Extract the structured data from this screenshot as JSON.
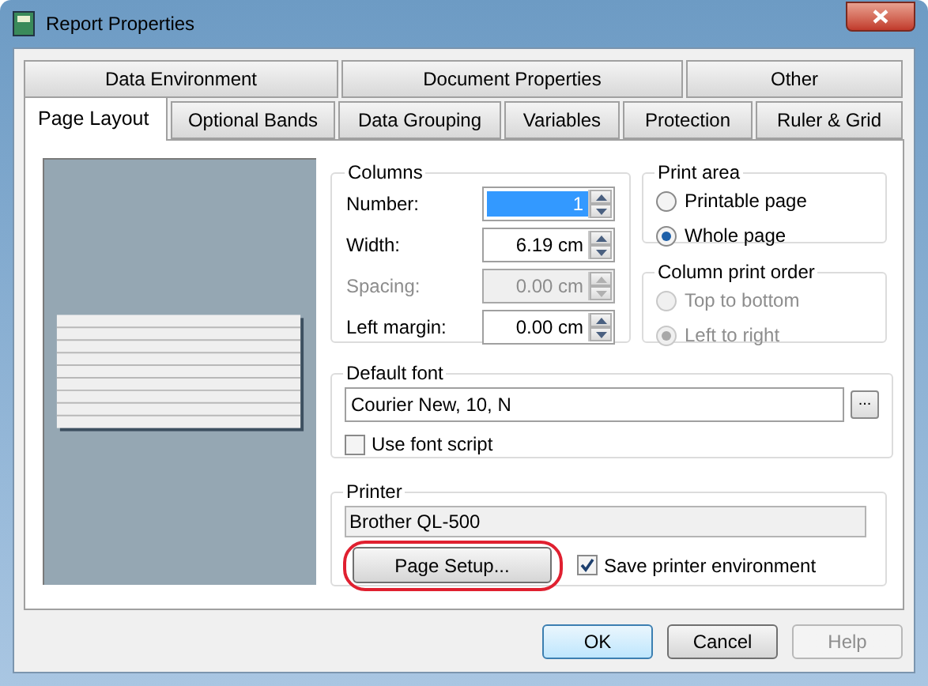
{
  "window": {
    "title": "Report Properties"
  },
  "tab_rows": [
    [
      {
        "label": "Data Environment",
        "selected": false
      },
      {
        "label": "Document Properties",
        "selected": false
      },
      {
        "label": "Other",
        "selected": false
      }
    ],
    [
      {
        "label": "Page Layout",
        "selected": true
      },
      {
        "label": "Optional Bands",
        "selected": false
      },
      {
        "label": "Data Grouping",
        "selected": false
      },
      {
        "label": "Variables",
        "selected": false
      },
      {
        "label": "Protection",
        "selected": false
      },
      {
        "label": "Ruler & Grid",
        "selected": false
      }
    ]
  ],
  "columns": {
    "title": "Columns",
    "fields": [
      {
        "label": "Number:",
        "value": "1",
        "disabled": false,
        "text_selected": true
      },
      {
        "label": "Width:",
        "value": "6.19 cm",
        "disabled": false,
        "text_selected": false
      },
      {
        "label": "Spacing:",
        "value": "0.00 cm",
        "disabled": true,
        "text_selected": false
      },
      {
        "label": "Left margin:",
        "value": "0.00 cm",
        "disabled": false,
        "text_selected": false
      }
    ]
  },
  "print_area": {
    "title": "Print area",
    "options": [
      {
        "label": "Printable page",
        "selected": false,
        "disabled": false
      },
      {
        "label": "Whole page",
        "selected": true,
        "disabled": false
      }
    ]
  },
  "column_print_order": {
    "title": "Column print order",
    "options": [
      {
        "label": "Top to bottom",
        "selected": false,
        "disabled": true
      },
      {
        "label": "Left to right",
        "selected": true,
        "disabled": true
      }
    ]
  },
  "default_font": {
    "title": "Default font",
    "value": "Courier New, 10, N",
    "browse_button": "...",
    "checkbox": {
      "label": "Use font script",
      "checked": false
    }
  },
  "printer": {
    "title": "Printer",
    "value": "Brother QL-500",
    "button": {
      "label": "Page Setup...",
      "circled": true
    },
    "checkbox": {
      "label": "Save printer environment",
      "checked": true
    }
  },
  "buttons": [
    {
      "label": "OK",
      "default": true,
      "disabled": false
    },
    {
      "label": "Cancel",
      "default": false,
      "disabled": false
    },
    {
      "label": "Help",
      "default": false,
      "disabled": true
    }
  ]
}
